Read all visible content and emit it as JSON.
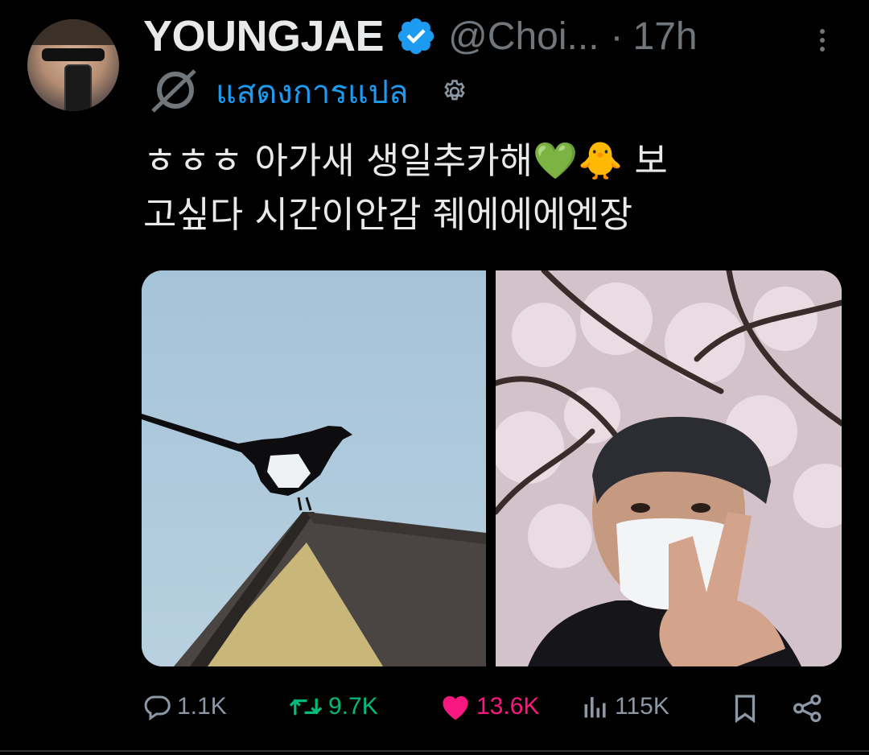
{
  "tweet": {
    "author_name": "YOUNGJAE",
    "handle": "@Choi...",
    "separator": "·",
    "time": "17h",
    "translate_label": "แสดงการแปล",
    "text_line1": "ㅎㅎㅎ 아가새 생일추카해💚🐥 보",
    "text_line2": "고싶다 시간이안감 줴에에에엔장"
  },
  "actions": {
    "replies": "1.1K",
    "retweets": "9.7K",
    "likes": "13.6K",
    "views": "115K"
  },
  "colors": {
    "background": "#000000",
    "text": "#e7e9ea",
    "muted": "#71767b",
    "link": "#1d9bf0",
    "verified": "#1d9bf0",
    "retweet": "#00ba7c",
    "like": "#f91880"
  },
  "icons": {
    "verified": "verified-badge-icon",
    "more": "more-dots-icon",
    "translate": "translate-globe-icon",
    "settings": "gear-icon",
    "reply": "reply-bubble-icon",
    "retweet": "retweet-icon",
    "like": "heart-filled-icon",
    "views": "views-bar-icon",
    "bookmark": "bookmark-icon",
    "share": "share-icon"
  }
}
